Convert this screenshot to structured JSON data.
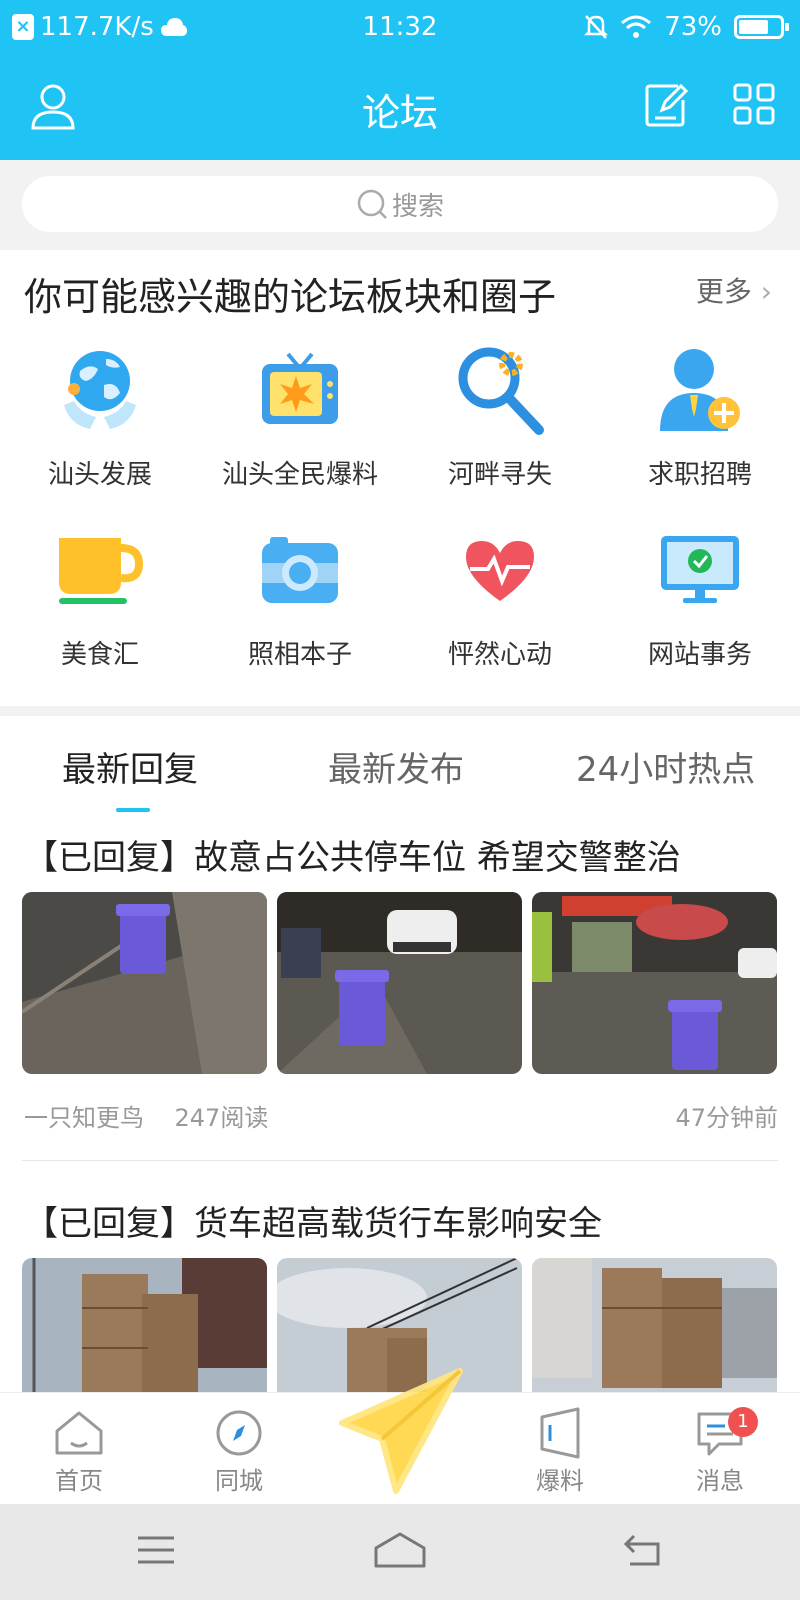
{
  "status_bar": {
    "network_speed": "117.7K/s",
    "time": "11:32",
    "battery": "73%",
    "battery_level": 0.73
  },
  "header": {
    "title": "论坛",
    "left_icon": "user-icon",
    "right_icons": [
      "edit-icon",
      "grid-icon"
    ]
  },
  "search": {
    "placeholder": "搜索"
  },
  "forums_section": {
    "title": "你可能感兴趣的论坛板块和圈子",
    "more": "更多",
    "items": [
      {
        "label": "汕头发展",
        "icon": "globe-hands-icon"
      },
      {
        "label": "汕头全民爆料",
        "icon": "tv-icon"
      },
      {
        "label": "河畔寻失",
        "icon": "magnifier-gear-icon"
      },
      {
        "label": "求职招聘",
        "icon": "person-plus-icon"
      },
      {
        "label": "美食汇",
        "icon": "cup-icon"
      },
      {
        "label": "照相本子",
        "icon": "camera-icon"
      },
      {
        "label": "怦然心动",
        "icon": "heart-pulse-icon"
      },
      {
        "label": "网站事务",
        "icon": "monitor-check-icon"
      }
    ]
  },
  "feed_tabs": [
    "最新回复",
    "最新发布",
    "24小时热点"
  ],
  "active_tab": 0,
  "posts": [
    {
      "title": "【已回复】故意占公共停车位 希望交警整治",
      "author": "一只知更鸟",
      "reads": "247阅读",
      "time": "47分钟前"
    },
    {
      "title": "【已回复】货车超高载货行车影响安全"
    }
  ],
  "bottom_nav": {
    "items": [
      {
        "label": "首页",
        "icon": "home-icon"
      },
      {
        "label": "同城",
        "icon": "compass-icon"
      },
      {
        "label": "",
        "icon": "paper-plane-icon"
      },
      {
        "label": "爆料",
        "icon": "flag-icon"
      },
      {
        "label": "消息",
        "icon": "message-icon",
        "badge": "1"
      }
    ]
  },
  "colors": {
    "accent": "#1fc3f4",
    "badge": "#f05050",
    "plane": "#ffd84a"
  }
}
